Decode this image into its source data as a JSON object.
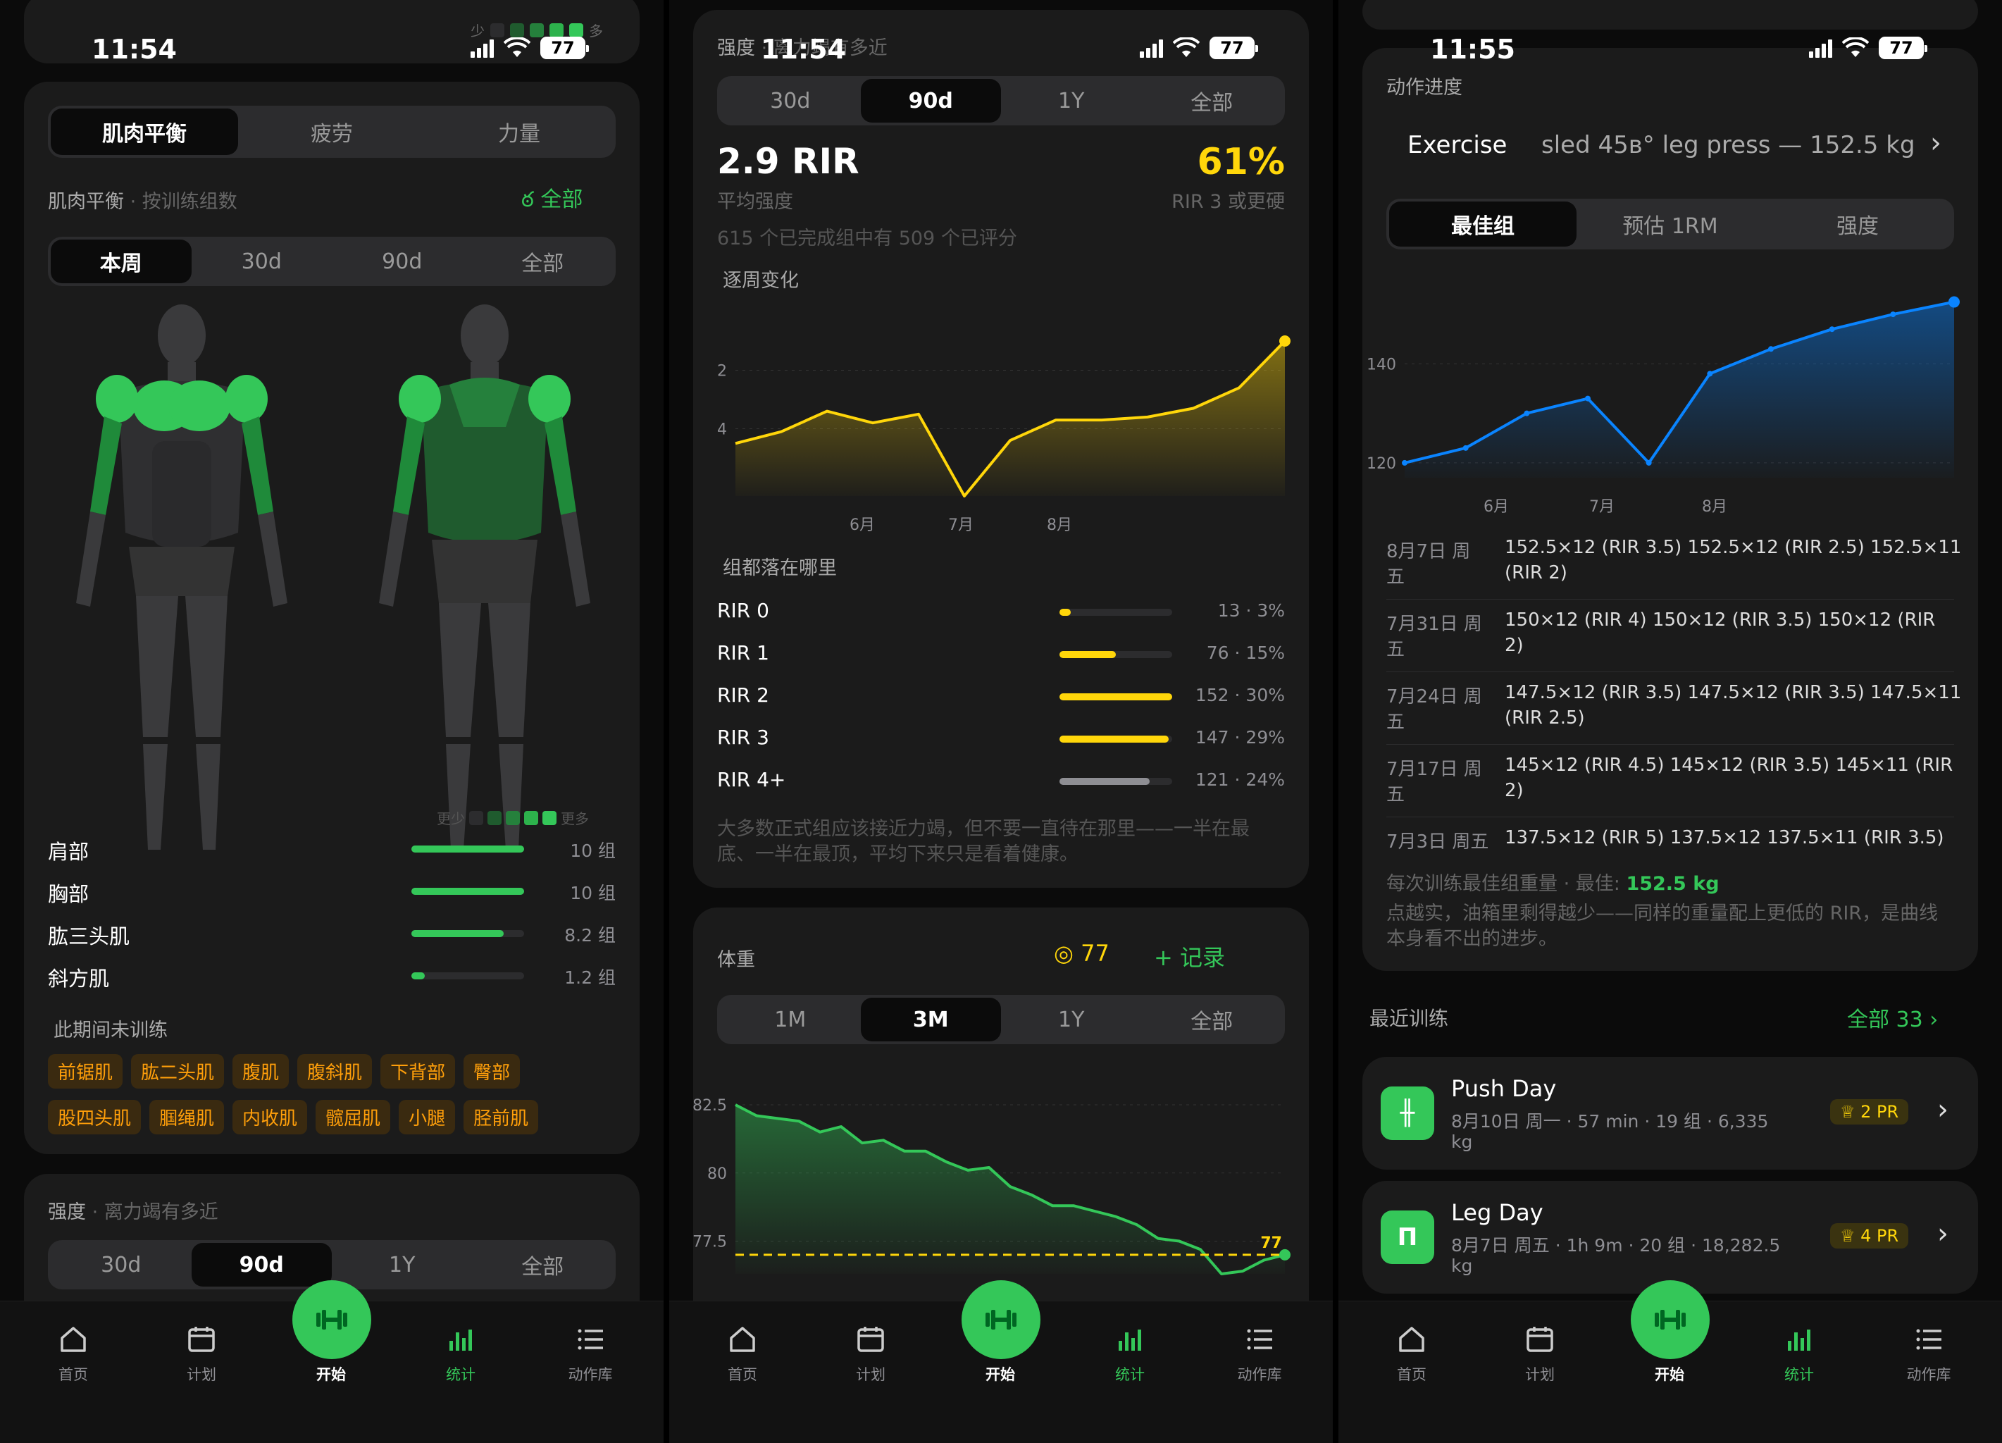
{
  "status": {
    "time1": "11:54",
    "time2": "11:54",
    "time3": "11:55",
    "battery": "77",
    "legend_less": "少",
    "legend_more": "多"
  },
  "s1": {
    "top_tabs": [
      "肌肉平衡",
      "疲劳",
      "力量"
    ],
    "section_title": "肌肉平衡",
    "section_sub": "· 按训练组数",
    "all_label": "全部",
    "range_tabs": [
      "本周",
      "30d",
      "90d",
      "全部"
    ],
    "heat_less": "更少",
    "heat_more": "更多",
    "muscles": [
      {
        "name": "肩部",
        "value": "10 组",
        "fraction": 1.0
      },
      {
        "name": "胸部",
        "value": "10 组",
        "fraction": 1.0
      },
      {
        "name": "肱三头肌",
        "value": "8.2 组",
        "fraction": 0.82
      },
      {
        "name": "斜方肌",
        "value": "1.2 组",
        "fraction": 0.12
      }
    ],
    "untrained_title": "此期间未训练",
    "untrained": [
      "前锯肌",
      "肱二头肌",
      "腹肌",
      "腹斜肌",
      "下背部",
      "臀部",
      "股四头肌",
      "腘绳肌",
      "内收肌",
      "髋屈肌",
      "小腿",
      "胫前肌"
    ],
    "intensity_title": "强度",
    "intensity_sub": "· 离力竭有多近",
    "intensity_tabs": [
      "30d",
      "90d",
      "1Y",
      "全部"
    ]
  },
  "s2": {
    "header_title": "强度",
    "header_sub": "· 离力竭有多近",
    "range_tabs": [
      "30d",
      "90d",
      "1Y",
      "全部"
    ],
    "avg_value": "2.9 RIR",
    "avg_label": "平均强度",
    "pct_value": "61%",
    "pct_label": "RIR 3 或更硬",
    "rated_note": "615 个已完成组中有 509 个已评分",
    "weekly_title": "逐周变化",
    "rir_dist_title": "组都落在哪里",
    "rir_rows": [
      {
        "label": "RIR 0",
        "value": "13 · 3%",
        "fraction": 0.03,
        "color": "#ffd60a"
      },
      {
        "label": "RIR 1",
        "value": "76 · 15%",
        "fraction": 0.15,
        "color": "#ffd60a"
      },
      {
        "label": "RIR 2",
        "value": "152 · 30%",
        "fraction": 0.3,
        "color": "#ffd60a"
      },
      {
        "label": "RIR 3",
        "value": "147 · 29%",
        "fraction": 0.29,
        "color": "#ffd60a"
      },
      {
        "label": "RIR 4+",
        "value": "121 · 24%",
        "fraction": 0.24,
        "color": "#8e8e93"
      }
    ],
    "advice": [
      "大多数正式组应该接近力竭，但不要一直待在那里——一半在最",
      "底、一半在最顶，平均下来只是看着健康。"
    ],
    "weight_title": "体重",
    "weight_target": "77",
    "weight_record": "+ 记录",
    "weight_tabs": [
      "1M",
      "3M",
      "1Y",
      "全部"
    ]
  },
  "s3": {
    "progress_title": "动作进度",
    "exercise_label": "Exercise",
    "exercise_value": "sled 45в° leg press — 152.5 kg",
    "metric_tabs": [
      "最佳组",
      "预估 1RM",
      "强度"
    ],
    "history": [
      {
        "date": [
          "8月7日 周",
          "五"
        ],
        "sets": [
          "152.5×12 (RIR 3.5) 152.5×12 (RIR 2.5) 152.5×11",
          "(RIR 2)"
        ]
      },
      {
        "date": [
          "7月31日 周",
          "五"
        ],
        "sets": [
          "150×12 (RIR 4) 150×12 (RIR 3.5) 150×12 (RIR",
          "2)"
        ]
      },
      {
        "date": [
          "7月24日 周",
          "五"
        ],
        "sets": [
          "147.5×12 (RIR 3.5) 147.5×12 (RIR 3.5) 147.5×11",
          "(RIR 2.5)"
        ]
      },
      {
        "date": [
          "7月17日 周",
          "五"
        ],
        "sets": [
          "145×12 (RIR 4.5) 145×12 (RIR 3.5) 145×11 (RIR",
          "2)"
        ]
      },
      {
        "date": [
          "7月3日 周五",
          ""
        ],
        "sets": [
          "137.5×12 (RIR 5) 137.5×12 137.5×11 (RIR 3.5)",
          ""
        ]
      }
    ],
    "best_label": "每次训练最佳组重量 · 最佳:",
    "best_value": "152.5 kg",
    "note": [
      "点越实，油箱里剩得越少——同样的重量配上更低的 RIR，是曲线",
      "本身看不出的进步。"
    ],
    "recent_title": "最近训练",
    "recent_all": "全部 33",
    "workouts": [
      {
        "name": "Push Day",
        "meta": [
          "8月10日 周一 · 57 min · 19 组 · 6,335",
          "kg"
        ],
        "pr": "2 PR"
      },
      {
        "name": "Leg Day",
        "meta": [
          "8月7日 周五 · 1h 9m · 20 组 · 18,282.5",
          "kg"
        ],
        "pr": "4 PR"
      }
    ]
  },
  "tabbar": {
    "home": "首页",
    "plan": "计划",
    "start": "开始",
    "stats": "统计",
    "library": "动作库"
  },
  "chart_data": [
    {
      "type": "area",
      "title": "逐周变化",
      "x_tick_labels": [
        "6月",
        "7月",
        "8月"
      ],
      "y_ticks": [
        2,
        4
      ],
      "y_inverted": true,
      "color": "#ffd60a",
      "values": [
        4.5,
        4.1,
        3.4,
        3.8,
        3.5,
        6.3,
        4.4,
        3.7,
        3.7,
        3.6,
        3.3,
        2.6,
        1.0
      ]
    },
    {
      "type": "area",
      "title": "体重",
      "y_ticks": [
        82.5,
        80,
        77.5
      ],
      "target": 77,
      "color": "#34c759",
      "values": [
        82.5,
        82.1,
        82.0,
        81.9,
        81.5,
        81.7,
        81.1,
        81.2,
        80.8,
        80.8,
        80.4,
        80.1,
        80.2,
        79.5,
        79.2,
        78.8,
        78.8,
        78.6,
        78.4,
        78.1,
        77.6,
        77.5,
        77.2,
        76.3,
        76.4,
        76.8,
        77.0
      ]
    },
    {
      "type": "line",
      "title": "动作进度",
      "x_tick_labels": [
        "6月",
        "7月",
        "8月"
      ],
      "y_ticks": [
        140,
        120
      ],
      "color": "#0a84ff",
      "values": [
        120,
        123,
        130,
        133,
        120,
        138,
        143,
        147,
        150,
        152.5
      ]
    }
  ]
}
